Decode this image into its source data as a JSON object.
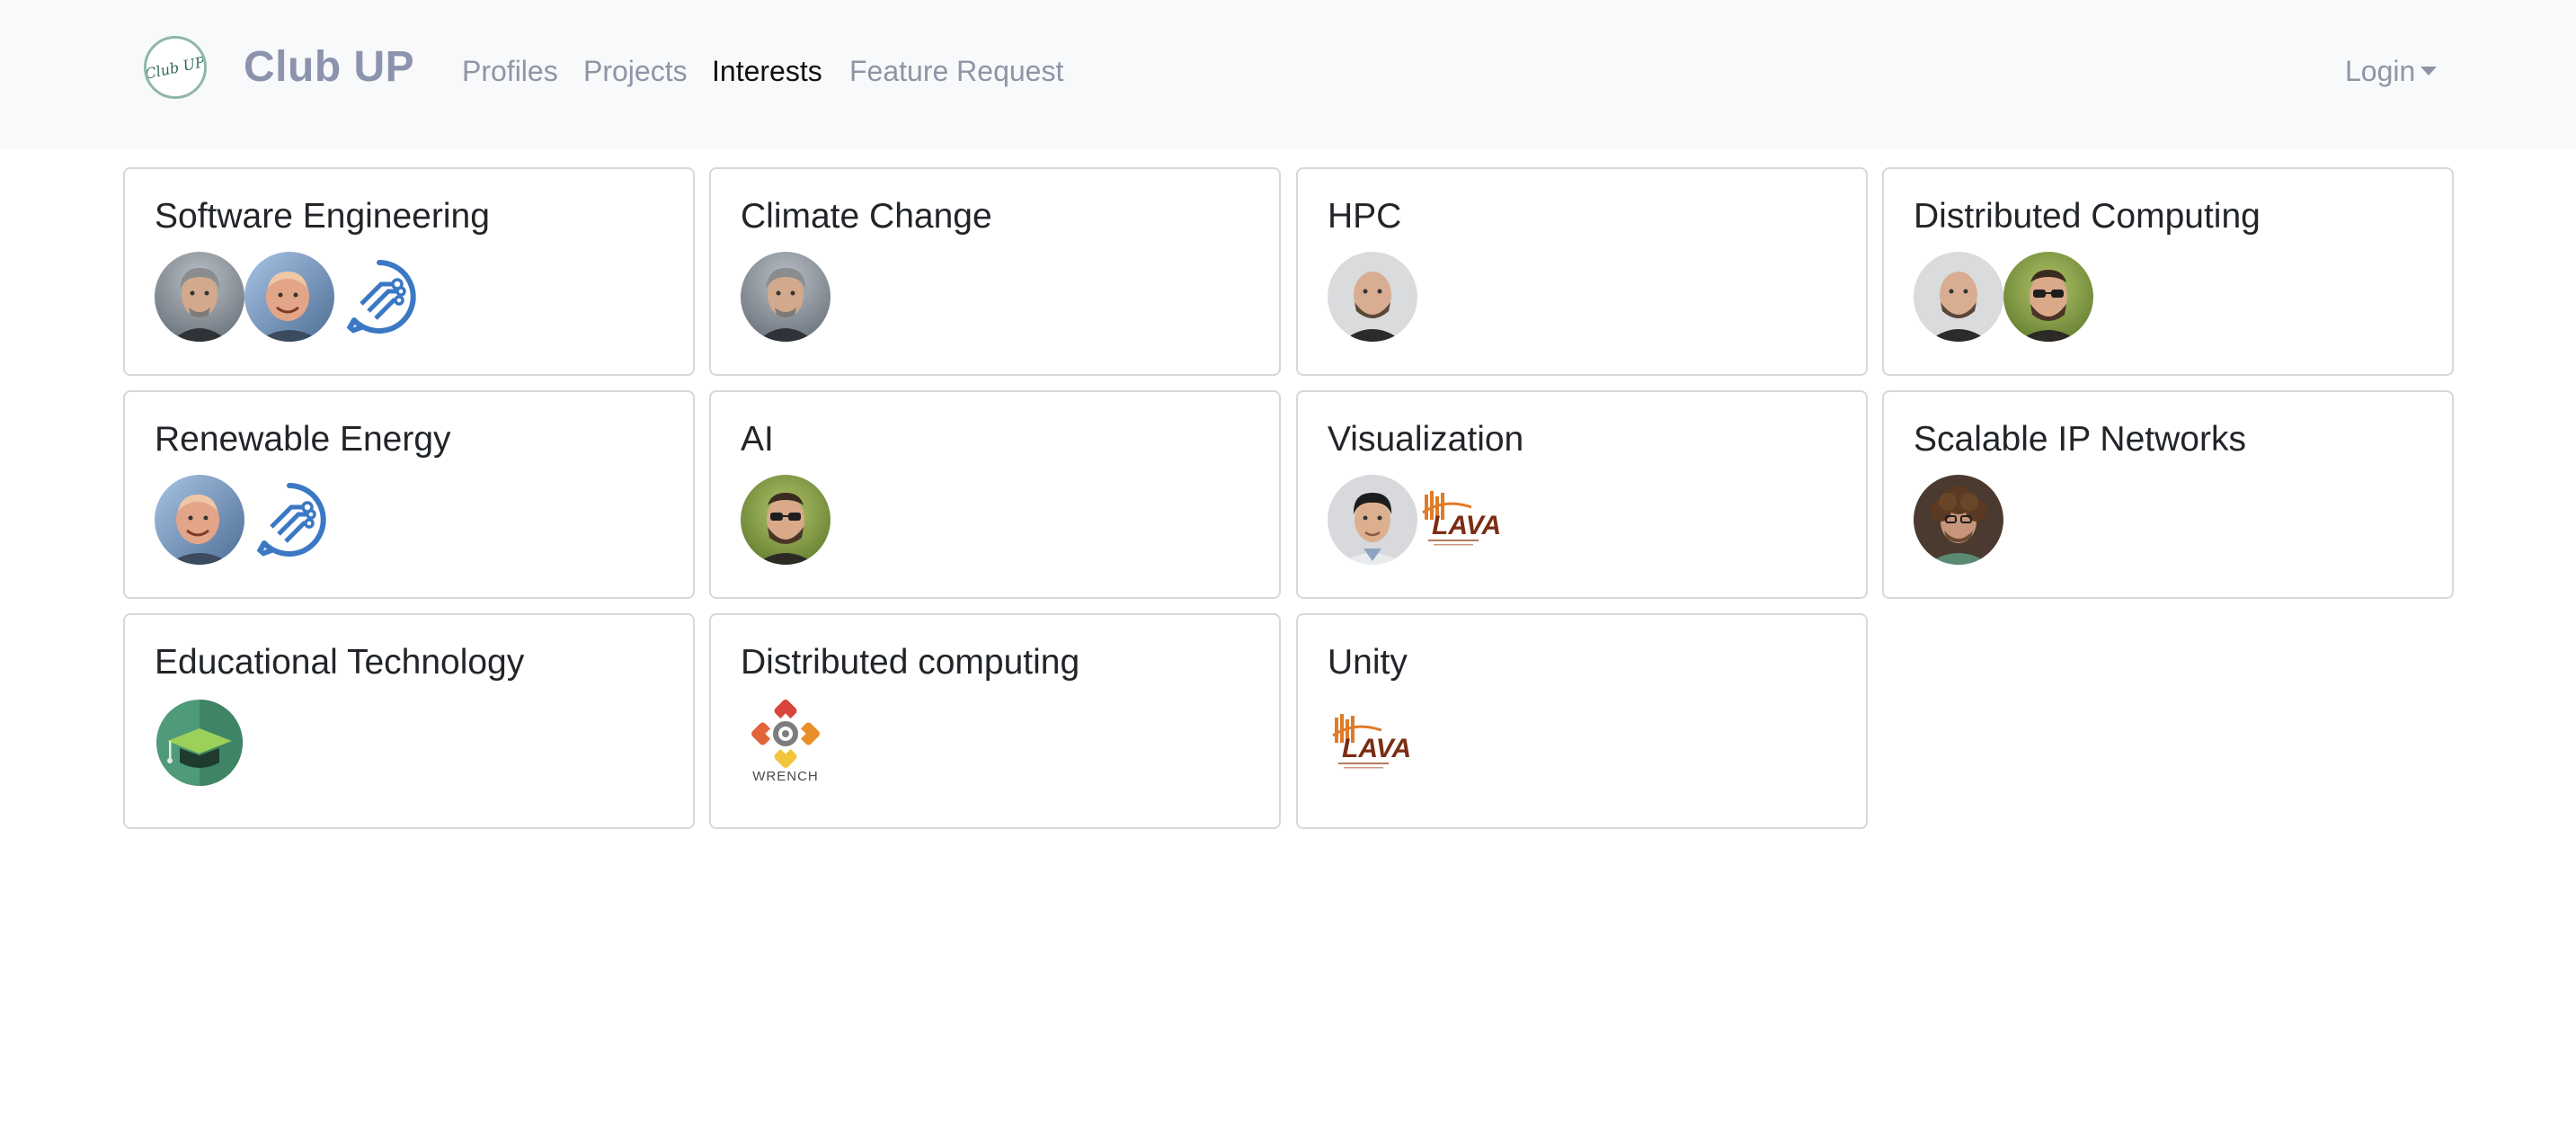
{
  "navbar": {
    "brand_logo_text": "Club UP",
    "brand": "Club UP",
    "links": [
      "Profiles",
      "Projects",
      "Interests",
      "Feature Request"
    ],
    "active_link": "Interests",
    "login": "Login"
  },
  "interests": [
    {
      "title": "Software Engineering",
      "members": [
        "person-gray-hair",
        "person-bald-smiling",
        "chat-circuit-logo"
      ]
    },
    {
      "title": "Climate Change",
      "members": [
        "person-gray-hair"
      ]
    },
    {
      "title": "HPC",
      "members": [
        "person-bald-beard"
      ]
    },
    {
      "title": "Distributed Computing",
      "members": [
        "person-bald-beard",
        "person-glasses-beard"
      ]
    },
    {
      "title": "Renewable Energy",
      "members": [
        "person-bald-smiling",
        "chat-circuit-logo"
      ]
    },
    {
      "title": "AI",
      "members": [
        "person-glasses-beard"
      ]
    },
    {
      "title": "Visualization",
      "members": [
        "person-black-hair",
        "lava-logo"
      ]
    },
    {
      "title": "Scalable IP Networks",
      "members": [
        "person-curly-hair"
      ]
    },
    {
      "title": "Educational Technology",
      "members": [
        "graduation-cap-logo"
      ]
    },
    {
      "title": "Distributed computing",
      "members": [
        "wrench-logo"
      ]
    },
    {
      "title": "Unity",
      "members": [
        "lava-logo"
      ]
    }
  ],
  "logo_text": {
    "lava": "LAVA",
    "wrench": "WRENCH"
  },
  "colors": {
    "navbar_bg": "#f8f9fa",
    "brand": "#8c93ad",
    "nav_link": "#9094a6",
    "nav_active": "#111111",
    "card_border": "#d6d8db",
    "chat_logo_blue": "#3b78c4",
    "lava_orange": "#e07b28",
    "lava_brown": "#7a2d12"
  }
}
